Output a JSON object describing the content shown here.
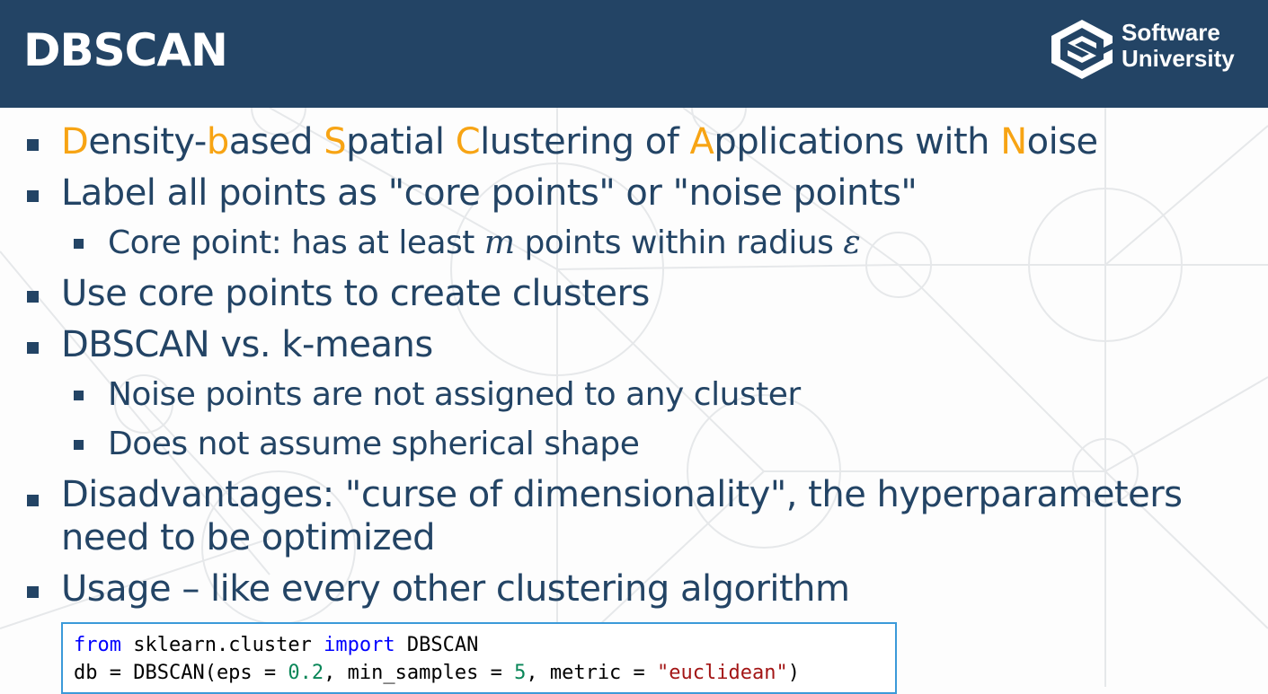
{
  "header": {
    "title": "DBSCAN",
    "logo_line1": "Software",
    "logo_line2": "University"
  },
  "bullets": {
    "b1": {
      "parts": [
        "D",
        "ensity-",
        "b",
        "ased ",
        "S",
        "patial ",
        "C",
        "lustering of ",
        "A",
        "pplications with ",
        "N",
        "oise"
      ]
    },
    "b2": "Label all points as \"core points\" or \"noise points\"",
    "b2a": {
      "pre": "Core point: has at least ",
      "m": "m",
      "mid": " points within radius ",
      "eps": "ε"
    },
    "b3": "Use core points to create clusters",
    "b4": "DBSCAN vs. k-means",
    "b4a": "Noise points are not assigned to any cluster",
    "b4b": "Does not assume spherical shape",
    "b5": "Disadvantages: \"curse of dimensionality\", the hyperparameters need to be optimized",
    "b6": "Usage – like every other clustering algorithm"
  },
  "code": {
    "l1_kw1": "from",
    "l1_mod": " sklearn.cluster ",
    "l1_kw2": "import",
    "l1_name": " DBSCAN",
    "l2_a": "db = DBSCAN(eps = ",
    "l2_num1": "0.2",
    "l2_b": ", min_samples = ",
    "l2_num2": "5",
    "l2_c": ", metric = ",
    "l2_str": "\"euclidean\"",
    "l2_d": ")"
  },
  "colors": {
    "header_bg": "#234465",
    "text": "#234465",
    "highlight": "#f7a414",
    "code_border": "#3b9ad9"
  }
}
